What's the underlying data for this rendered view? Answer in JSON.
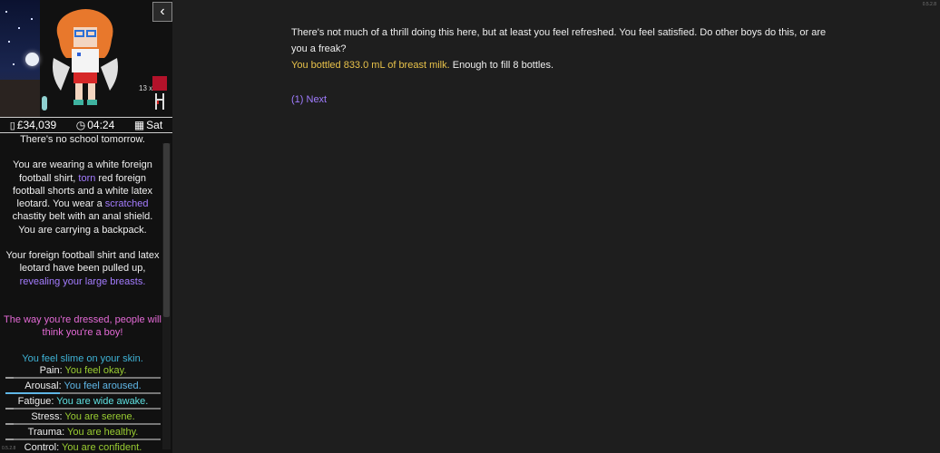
{
  "header": {
    "money": "£34,039",
    "time": "04:24",
    "day": "Sat",
    "item_count": "13 x"
  },
  "sidebar": {
    "school_note": "There's no school tomorrow.",
    "clothing": {
      "p1": "You are wearing a white foreign football shirt, ",
      "torn": "torn",
      "p2": " red foreign football shorts and a white latex leotard. You wear a ",
      "scratched": "scratched",
      "p3": " chastity belt with an anal shield. You are carrying a backpack."
    },
    "exposure": {
      "p1": "Your foreign football shirt and latex leotard have been pulled up,",
      "revealing": "revealing your large breasts."
    },
    "dressed_note": "The way you're dressed, people will think you're a boy!",
    "skin_note": "You feel slime on your skin.",
    "stats": [
      {
        "label": "Pain:",
        "value": "You feel okay.",
        "color": "green",
        "level": 0.05
      },
      {
        "label": "Arousal:",
        "value": "You feel aroused.",
        "color": "ltblue",
        "level": 0.35
      },
      {
        "label": "Fatigue:",
        "value": "You are wide awake.",
        "color": "cyan",
        "level": 0.05
      },
      {
        "label": "Stress:",
        "value": "You are serene.",
        "color": "green",
        "level": 0.05
      },
      {
        "label": "Trauma:",
        "value": "You are healthy.",
        "color": "green",
        "level": 0.05
      },
      {
        "label": "Control:",
        "value": "You are confident.",
        "color": "green",
        "level": 1.0
      }
    ]
  },
  "main": {
    "line1": "There's not much of a thrill doing this here, but at least you feel refreshed. You feel satisfied. Do other boys do this, or are you a freak?",
    "bottled": "You bottled 833.0 mL of breast milk.",
    "bottles_note": " Enough to fill 8 bottles.",
    "next_link": "(1) Next"
  },
  "version": {
    "right": "0.5.2.8",
    "left": "0.5.2.8"
  },
  "icons": {
    "collapse": "chevron-left-icon",
    "phone": "phone-icon",
    "clock": "clock-icon",
    "calendar": "calendar-icon"
  }
}
